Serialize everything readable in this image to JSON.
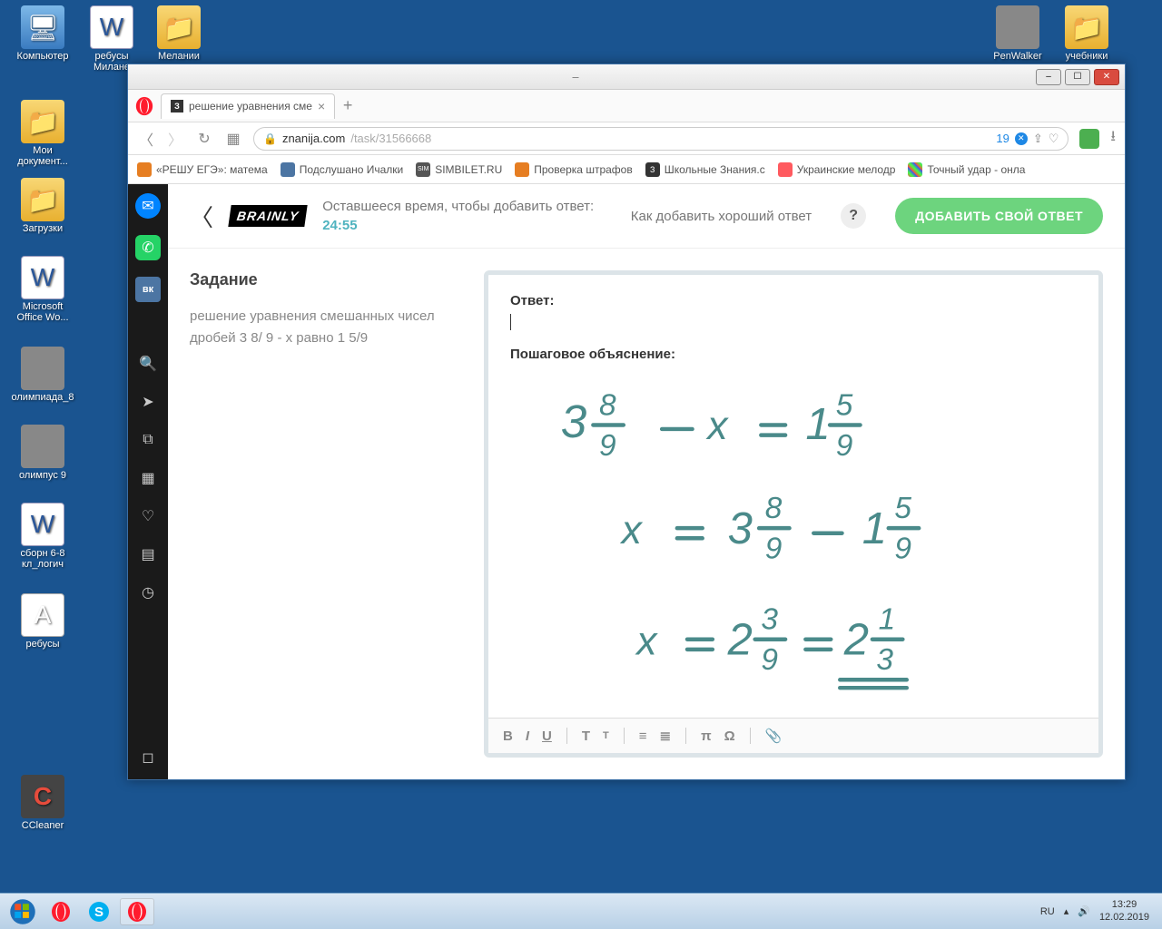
{
  "desktop": {
    "icons": [
      {
        "label": "Компьютер",
        "type": "computer"
      },
      {
        "label": "ребусы Милане",
        "type": "word"
      },
      {
        "label": "Мелании",
        "type": "folder"
      },
      {
        "label": "Мои документ...",
        "type": "folder"
      },
      {
        "label": "Загрузки",
        "type": "folder"
      },
      {
        "label": "Microsoft Office Wo...",
        "type": "word"
      },
      {
        "label": "олимпиада_8",
        "type": "thumb"
      },
      {
        "label": "олимпус 9",
        "type": "thumb"
      },
      {
        "label": "сборн 6-8 кл_логич",
        "type": "word"
      },
      {
        "label": "ребусы",
        "type": "file"
      },
      {
        "label": "CCleaner",
        "type": "cc"
      },
      {
        "label": "PenWalker",
        "type": "thumb"
      },
      {
        "label": "учебники",
        "type": "folder"
      }
    ]
  },
  "browser": {
    "tab": {
      "title": "решение уравнения сме",
      "favletter": "З"
    },
    "url": {
      "host": "znanija.com",
      "path": "/task/31566668"
    },
    "badge_count": "19",
    "bookmarks": [
      {
        "label": "«РЕШУ ЕГЭ»: матема",
        "color": "#e67e22"
      },
      {
        "label": "Подслушано Ичалки",
        "color": "#4c75a3"
      },
      {
        "label": "SIMBILET.RU",
        "color": "#555",
        "text": "SIM"
      },
      {
        "label": "Проверка штрафов",
        "color": "#e67e22"
      },
      {
        "label": "Школьные Знания.c",
        "color": "#333",
        "text": "З"
      },
      {
        "label": "Украинские мелодр",
        "color": "#ff5a5f"
      },
      {
        "label": "Точный удар - онла",
        "color": "#888"
      }
    ],
    "sidebar_vk": "вк"
  },
  "brainly": {
    "logo": "BRAINLY",
    "timer_label": "Оставшееся время, чтобы добавить ответ:",
    "timer_time": "24:55",
    "help_text": "Как добавить хороший ответ",
    "help_q": "?",
    "add_btn": "ДОБАВИТЬ СВОЙ ОТВЕТ",
    "task_title": "Задание",
    "task_text": "решение уравнения смешанных чисел дробей 3 8/ 9 - х равно 1 5/9",
    "answer_label": "Ответ:",
    "explain_label": "Пошаговое объяснение:",
    "handwritten_lines": [
      "3 8/9 − x = 1 5/9",
      "x = 3 8/9 − 1 5/9",
      "x = 2 3/9 = 2 1/3"
    ]
  },
  "taskbar": {
    "lang": "RU",
    "time": "13:29",
    "date": "12.02.2019"
  }
}
